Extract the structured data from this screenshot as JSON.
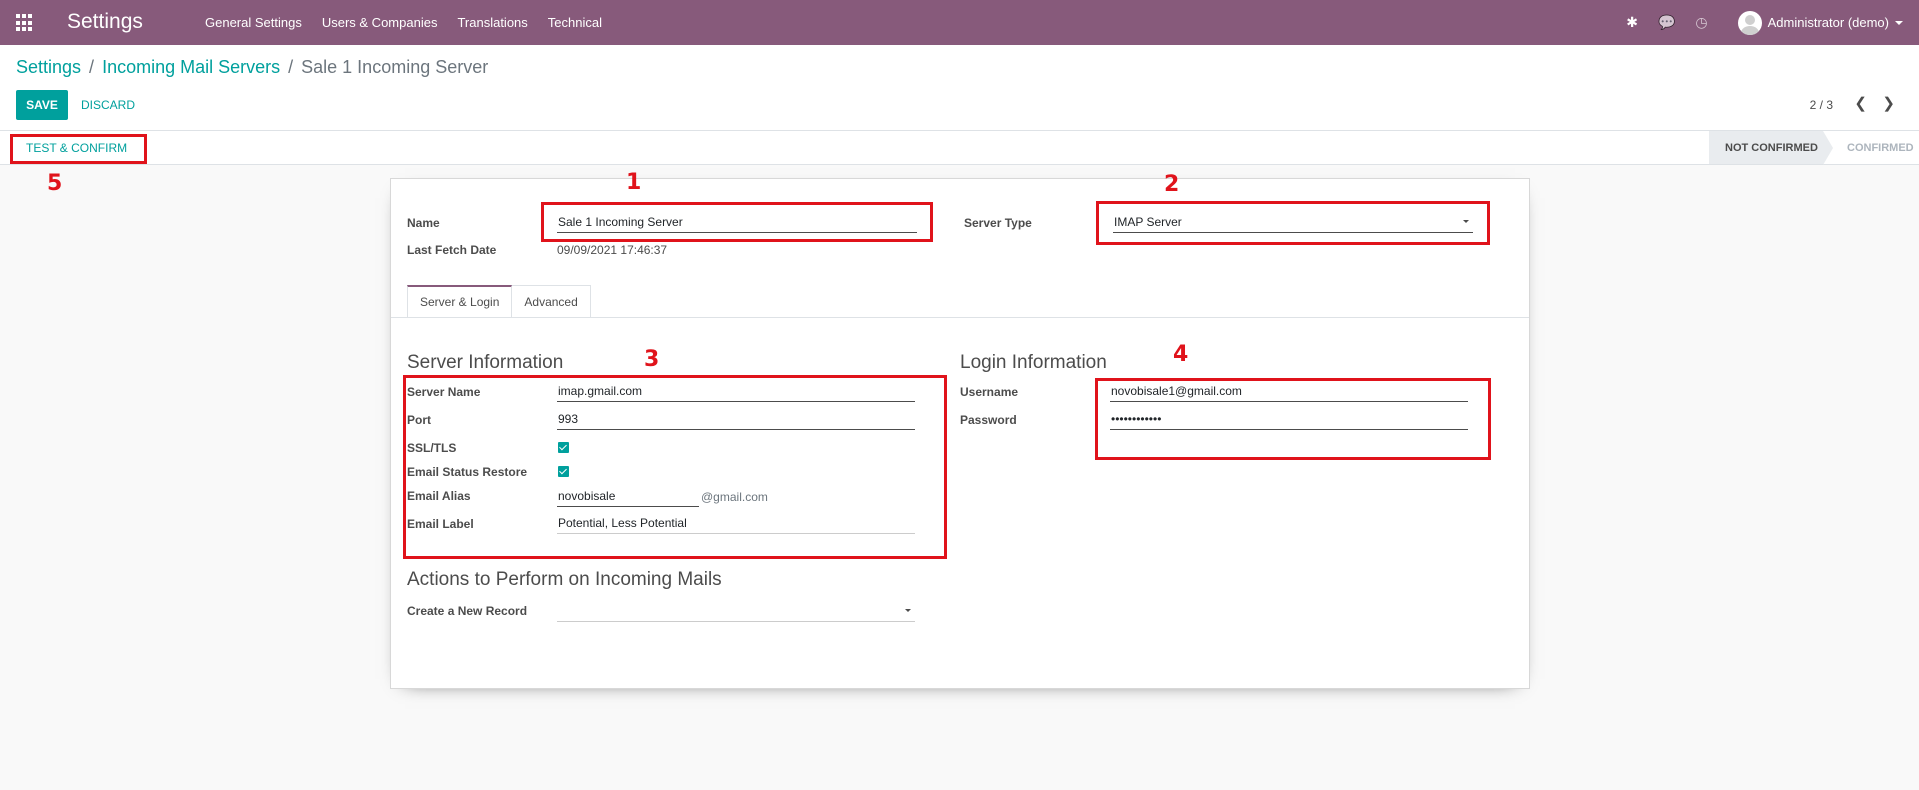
{
  "navbar": {
    "app_title": "Settings",
    "menu": [
      "General Settings",
      "Users & Companies",
      "Translations",
      "Technical"
    ],
    "user_name": "Administrator (demo)"
  },
  "breadcrumb": {
    "items": [
      "Settings",
      "Incoming Mail Servers"
    ],
    "current": "Sale 1 Incoming Server"
  },
  "toolbar": {
    "save_label": "SAVE",
    "discard_label": "DISCARD",
    "pager": "2 / 3"
  },
  "statusbar": {
    "test_label": "TEST & CONFIRM",
    "stages": [
      "NOT CONFIRMED",
      "CONFIRMED"
    ]
  },
  "form": {
    "name_label": "Name",
    "name_value": "Sale 1 Incoming Server",
    "last_fetch_label": "Last Fetch Date",
    "last_fetch_value": "09/09/2021 17:46:37",
    "server_type_label": "Server Type",
    "server_type_value": "IMAP Server",
    "tabs": [
      "Server & Login",
      "Advanced"
    ],
    "server_info": {
      "title": "Server Information",
      "server_name_label": "Server Name",
      "server_name_value": "imap.gmail.com",
      "port_label": "Port",
      "port_value": "993",
      "ssl_label": "SSL/TLS",
      "status_restore_label": "Email Status Restore",
      "alias_label": "Email Alias",
      "alias_value": "novobisale",
      "alias_domain": "@gmail.com",
      "email_label_label": "Email Label",
      "email_label_value": "Potential, Less Potential"
    },
    "login_info": {
      "title": "Login Information",
      "username_label": "Username",
      "username_value": "novobisale1@gmail.com",
      "password_label": "Password",
      "password_value": "••••••••••••"
    },
    "actions": {
      "title": "Actions to Perform on Incoming Mails",
      "create_label": "Create a New Record",
      "create_value": ""
    }
  },
  "annotations": [
    "1",
    "2",
    "3",
    "4",
    "5"
  ],
  "colors": {
    "brand": "#875a7b",
    "accent": "#00a09d",
    "annotation": "#e0131b"
  }
}
